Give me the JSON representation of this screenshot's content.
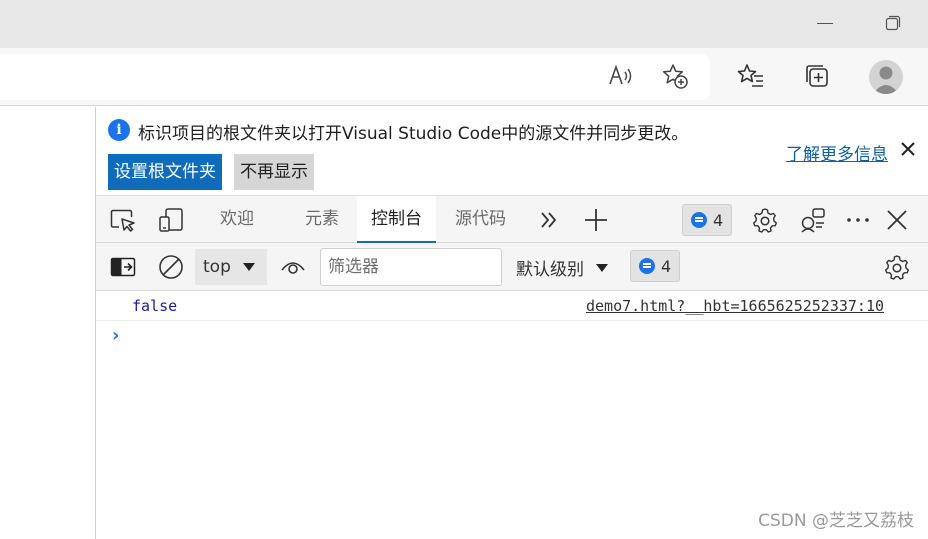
{
  "window": {
    "minimize_icon": "minimize-icon",
    "restore_icon": "restore-icon"
  },
  "toolbar": {
    "icons": [
      "read-aloud-icon",
      "add-favorite-icon",
      "favorites-icon",
      "collections-icon",
      "profile-icon"
    ]
  },
  "infobar": {
    "message": "标识项目的根文件夹以打开Visual Studio Code中的源文件并同步更改。",
    "primary_button": "设置根文件夹",
    "secondary_button": "不再显示",
    "link": "了解更多信息",
    "close_icon": "close-icon"
  },
  "tabs": [
    {
      "label": "欢迎",
      "active": false
    },
    {
      "label": "元素",
      "active": false
    },
    {
      "label": "控制台",
      "active": true
    },
    {
      "label": "源代码",
      "active": false
    }
  ],
  "tabsbar": {
    "issues_count": "4"
  },
  "consolebar": {
    "context": "top",
    "filter_placeholder": "筛选器",
    "level": "默认级别",
    "issues_count": "4"
  },
  "console": {
    "rows": [
      {
        "value": "false",
        "source": "demo7.html?__hbt=1665625252337:10"
      }
    ],
    "prompt": "›"
  },
  "watermark": "CSDN @芝芝又荔枝",
  "colors": {
    "accent": "#0f6cbd",
    "badge_blue": "#1a73e8",
    "log_value": "#1a1aa6"
  }
}
